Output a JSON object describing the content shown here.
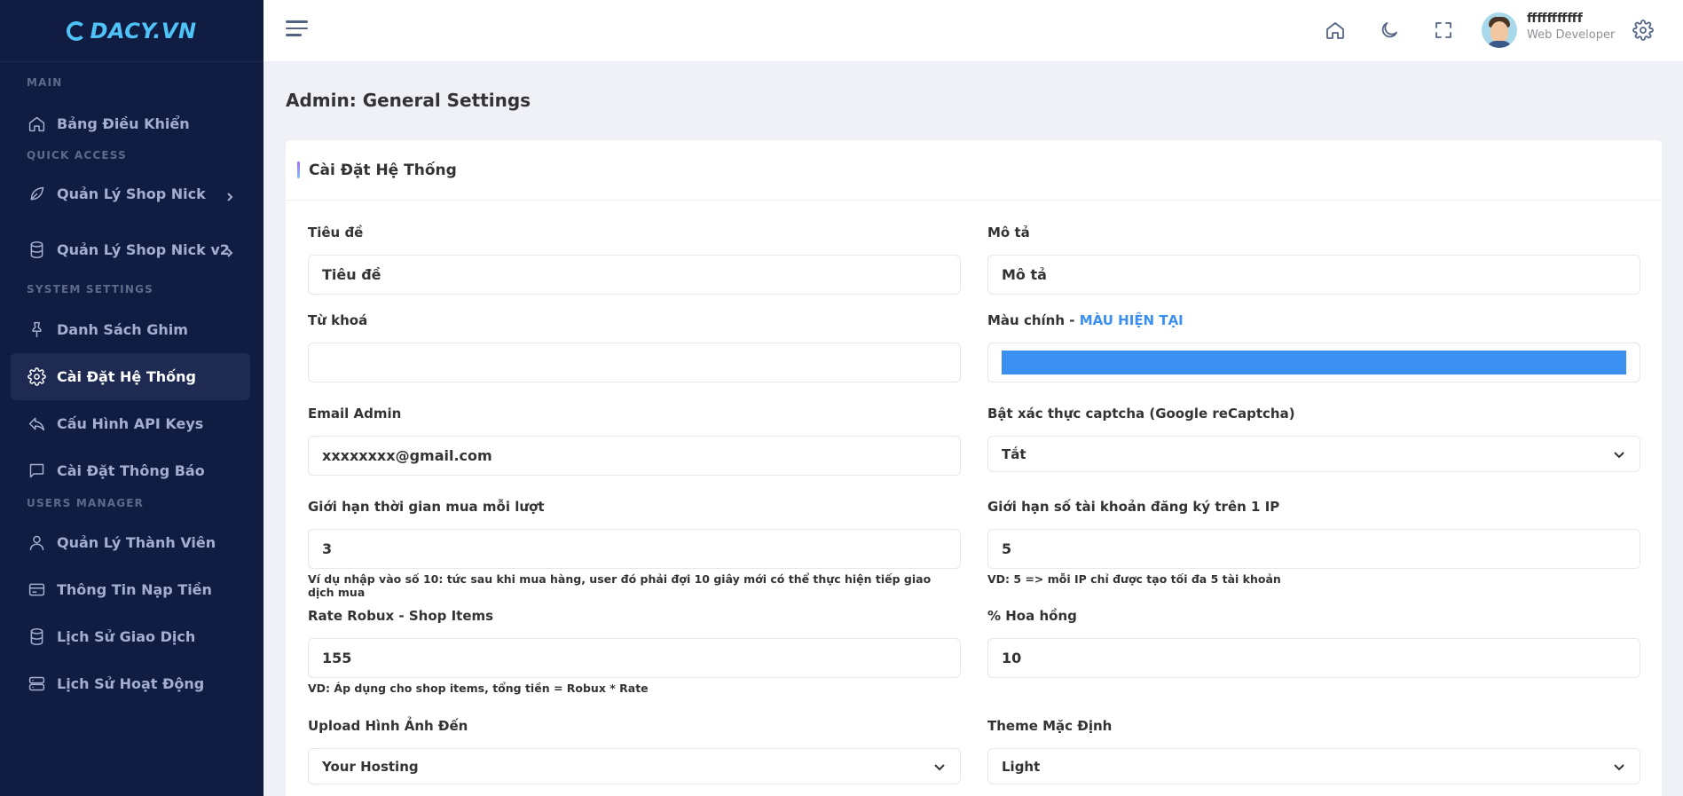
{
  "logo": {
    "text": "DACY.VN"
  },
  "sidebar": {
    "sections": {
      "main": "MAIN",
      "quick": "QUICK ACCESS",
      "system": "SYSTEM SETTINGS",
      "users": "USERS MANAGER"
    },
    "items": [
      {
        "label": "Bảng Điều Khiển",
        "icon": "home-icon"
      },
      {
        "label": "Quản Lý Shop Nick",
        "icon": "leaf-icon"
      },
      {
        "label": "Quản Lý Shop Nick v2",
        "icon": "database-icon"
      },
      {
        "label": "Danh Sách Ghim",
        "icon": "pin-icon"
      },
      {
        "label": "Cài Đặt Hệ Thống",
        "icon": "gear-icon",
        "active": true
      },
      {
        "label": "Cấu Hình API Keys",
        "icon": "reply-icon"
      },
      {
        "label": "Cài Đặt Thông Báo",
        "icon": "message-icon"
      },
      {
        "label": "Quản Lý Thành Viên",
        "icon": "user-icon"
      },
      {
        "label": "Thông Tin Nạp Tiền",
        "icon": "credit-card-icon"
      },
      {
        "label": "Lịch Sử Giao Dịch",
        "icon": "database-icon"
      },
      {
        "label": "Lịch Sử Hoạt Động",
        "icon": "server-icon"
      }
    ]
  },
  "header": {
    "user_name": "fffffffffff",
    "user_role": "Web Developer"
  },
  "page": {
    "title": "Admin: General Settings"
  },
  "card": {
    "title": "Cài Đặt Hệ Thống",
    "fields": {
      "tieu_de": {
        "label": "Tiêu đề",
        "value": "Tiêu đề"
      },
      "mo_ta": {
        "label": "Mô tả",
        "value": "Mô tả"
      },
      "tu_khoa": {
        "label": "Từ khoá",
        "value": ""
      },
      "mau_chinh": {
        "label": "Màu chính - ",
        "link": "MÀU HIỆN TẠI",
        "color": "#3b8ff0"
      },
      "email": {
        "label": "Email Admin",
        "value": "xxxxxxxx@gmail.com"
      },
      "captcha": {
        "label": "Bật xác thực captcha (Google reCaptcha)",
        "value": "Tắt"
      },
      "gioi_han_tg": {
        "label": "Giới hạn thời gian mua mỗi lượt",
        "value": "3",
        "help": "Ví dụ nhập vào số 10: tức sau khi mua hàng, user đó phải đợi 10 giây mới có thể thực hiện tiếp giao dịch mua"
      },
      "gioi_han_ip": {
        "label": "Giới hạn số tài khoản đăng ký trên 1 IP",
        "value": "5",
        "help": "VD: 5 => mỗi IP chỉ được tạo tối đa 5 tài khoản"
      },
      "rate_robux": {
        "label": "Rate Robux - Shop Items",
        "value": "155",
        "help": "VD: Áp dụng cho shop items, tổng tiền = Robux * Rate"
      },
      "hoa_hong": {
        "label": "% Hoa hồng",
        "value": "10"
      },
      "upload": {
        "label": "Upload Hình Ảnh Đến",
        "value": "Your Hosting"
      },
      "theme": {
        "label": "Theme Mặc Định",
        "value": "Light"
      }
    }
  }
}
